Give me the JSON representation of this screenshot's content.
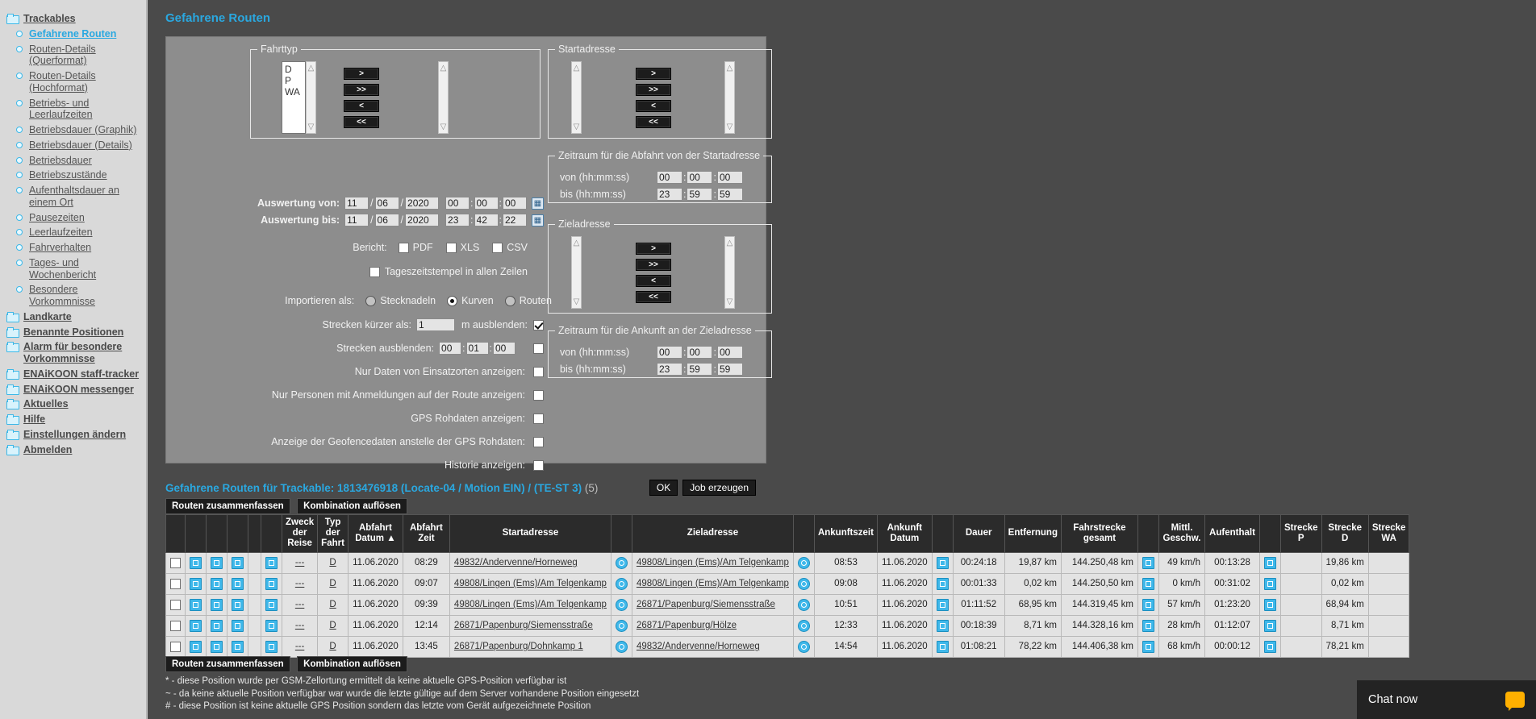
{
  "sidebar": {
    "items": [
      {
        "label": "Trackables",
        "type": "folder",
        "active": false
      },
      {
        "label": "Gefahrene Routen",
        "type": "leaf",
        "active": true
      },
      {
        "label": "Routen-Details (Querformat)",
        "type": "leaf",
        "active": false
      },
      {
        "label": "Routen-Details (Hochformat)",
        "type": "leaf",
        "active": false
      },
      {
        "label": "Betriebs- und Leerlaufzeiten",
        "type": "leaf",
        "active": false
      },
      {
        "label": "Betriebsdauer (Graphik)",
        "type": "leaf",
        "active": false
      },
      {
        "label": "Betriebsdauer (Details)",
        "type": "leaf",
        "active": false
      },
      {
        "label": "Betriebsdauer",
        "type": "leaf",
        "active": false
      },
      {
        "label": "Betriebszustände",
        "type": "leaf",
        "active": false
      },
      {
        "label": "Aufenthaltsdauer an einem Ort",
        "type": "leaf",
        "active": false
      },
      {
        "label": "Pausezeiten",
        "type": "leaf",
        "active": false
      },
      {
        "label": "Leerlaufzeiten",
        "type": "leaf",
        "active": false
      },
      {
        "label": "Fahrverhalten",
        "type": "leaf",
        "active": false
      },
      {
        "label": "Tages- und Wochenbericht",
        "type": "leaf",
        "active": false
      },
      {
        "label": "Besondere Vorkommnisse",
        "type": "leaf",
        "active": false
      },
      {
        "label": "Landkarte",
        "type": "folder",
        "active": false
      },
      {
        "label": "Benannte Positionen",
        "type": "folder",
        "active": false
      },
      {
        "label": "Alarm für besondere Vorkommnisse",
        "type": "folder",
        "active": false
      },
      {
        "label": "ENAiKOON staff-tracker",
        "type": "folder",
        "active": false
      },
      {
        "label": "ENAiKOON messenger",
        "type": "folder",
        "active": false
      },
      {
        "label": "Aktuelles",
        "type": "folder",
        "active": false
      },
      {
        "label": "Hilfe",
        "type": "folder",
        "active": false
      },
      {
        "label": "Einstellungen ändern",
        "type": "folder",
        "active": false
      },
      {
        "label": "Abmelden",
        "type": "folder",
        "active": false
      }
    ]
  },
  "page": {
    "title": "Gefahrene Routen",
    "accent_color": "#2aa8e0"
  },
  "form": {
    "fahrttyp": {
      "legend": "Fahrttyp",
      "available": [
        "D",
        "P",
        "WA"
      ],
      "selected": [],
      "buttons": [
        ">",
        ">>",
        "<",
        "<<"
      ]
    },
    "startadresse": {
      "legend": "Startadresse",
      "available": [],
      "selected": [],
      "buttons": [
        ">",
        ">>",
        "<",
        "<<"
      ]
    },
    "zieladresse": {
      "legend": "Zieladresse",
      "available": [],
      "selected": [],
      "buttons": [
        ">",
        ">>",
        "<",
        "<<"
      ]
    },
    "auswertung_von": {
      "label": "Auswertung von:",
      "day": "11",
      "month": "06",
      "year": "2020",
      "hh": "00",
      "mm": "00",
      "ss": "00"
    },
    "auswertung_bis": {
      "label": "Auswertung bis:",
      "day": "11",
      "month": "06",
      "year": "2020",
      "hh": "23",
      "mm": "42",
      "ss": "22"
    },
    "bericht": {
      "label": "Bericht:",
      "options": [
        {
          "label": "PDF",
          "checked": false
        },
        {
          "label": "XLS",
          "checked": false
        },
        {
          "label": "CSV",
          "checked": false
        }
      ]
    },
    "tageszeitstempel": {
      "label": "Tageszeitstempel in allen Zeilen",
      "checked": false
    },
    "importieren_als": {
      "label": "Importieren als:",
      "options": [
        {
          "label": "Stecknadeln",
          "selected": false
        },
        {
          "label": "Kurven",
          "selected": true
        },
        {
          "label": "Routen",
          "selected": false
        }
      ]
    },
    "strecken_kuerzer": {
      "label": "Strecken kürzer als:",
      "value": "1",
      "unit_label": "m ausblenden:",
      "checked": true
    },
    "strecken_ausblenden": {
      "label": "Strecken ausblenden:",
      "hh": "00",
      "mm": "01",
      "ss": "00",
      "checked": false
    },
    "nur_einsatzorte": {
      "label": "Nur Daten von Einsatzorten anzeigen:",
      "checked": false
    },
    "nur_personen": {
      "label": "Nur Personen mit Anmeldungen auf der Route anzeigen:",
      "checked": false
    },
    "gps_rohdaten": {
      "label": "GPS Rohdaten anzeigen:",
      "checked": false
    },
    "geofence": {
      "label": "Anzeige der Geofencedaten anstelle der GPS Rohdaten:",
      "checked": false
    },
    "historie": {
      "label": "Historie anzeigen:",
      "checked": false
    },
    "abfahrt_zeitraum": {
      "legend": "Zeitraum für die Abfahrt von der Startadresse",
      "von_label": "von (hh:mm:ss)",
      "von": {
        "hh": "00",
        "mm": "00",
        "ss": "00"
      },
      "bis_label": "bis (hh:mm:ss)",
      "bis": {
        "hh": "23",
        "mm": "59",
        "ss": "59"
      }
    },
    "ankunft_zeitraum": {
      "legend": "Zeitraum für die Ankunft an der Zieladresse",
      "von_label": "von (hh:mm:ss)",
      "von": {
        "hh": "00",
        "mm": "00",
        "ss": "00"
      },
      "bis_label": "bis (hh:mm:ss)",
      "bis": {
        "hh": "23",
        "mm": "59",
        "ss": "59"
      }
    },
    "ok_label": "OK",
    "job_label": "Job erzeugen"
  },
  "results": {
    "title": "Gefahrene Routen für Trackable: 1813476918 (Locate-04 / Motion EIN) / (TE-ST 3)",
    "count": "(5)",
    "btn_summarize": "Routen zusammenfassen",
    "btn_dissolve": "Kombination auflösen",
    "headers": [
      "",
      "",
      "",
      "",
      "",
      "",
      "Zweck der Reise",
      "Typ der Fahrt",
      "Abfahrt Datum ▲",
      "Abfahrt Zeit",
      "Startadresse",
      "",
      "Zieladresse",
      "",
      "Ankunftszeit",
      "Ankunft Datum",
      "",
      "Dauer",
      "Entfernung",
      "Fahrstrecke gesamt",
      "",
      "Mittl. Geschw.",
      "Aufenthalt",
      "",
      "Strecke P",
      "Strecke D",
      "Strecke WA"
    ],
    "rows": [
      {
        "zweck": "---",
        "typ": "D",
        "abfahrt_datum": "11.06.2020",
        "abfahrt_zeit": "08:29",
        "startadresse": "49832/Andervenne/Horneweg",
        "zieladresse": "49808/Lingen (Ems)/Am Telgenkamp",
        "ankunftszeit": "08:53",
        "ankunft_datum": "11.06.2020",
        "dauer": "00:24:18",
        "entfernung": "19,87 km",
        "fahrstrecke_gesamt": "144.250,48 km",
        "mittl_geschw": "49 km/h",
        "aufenthalt": "00:13:28",
        "strecke_p": "",
        "strecke_d": "19,86 km",
        "strecke_wa": ""
      },
      {
        "zweck": "---",
        "typ": "D",
        "abfahrt_datum": "11.06.2020",
        "abfahrt_zeit": "09:07",
        "startadresse": "49808/Lingen (Ems)/Am Telgenkamp",
        "zieladresse": "49808/Lingen (Ems)/Am Telgenkamp",
        "ankunftszeit": "09:08",
        "ankunft_datum": "11.06.2020",
        "dauer": "00:01:33",
        "entfernung": "0,02 km",
        "fahrstrecke_gesamt": "144.250,50 km",
        "mittl_geschw": "0 km/h",
        "aufenthalt": "00:31:02",
        "strecke_p": "",
        "strecke_d": "0,02 km",
        "strecke_wa": ""
      },
      {
        "zweck": "---",
        "typ": "D",
        "abfahrt_datum": "11.06.2020",
        "abfahrt_zeit": "09:39",
        "startadresse": "49808/Lingen (Ems)/Am Telgenkamp",
        "zieladresse": "26871/Papenburg/Siemensstraße",
        "ankunftszeit": "10:51",
        "ankunft_datum": "11.06.2020",
        "dauer": "01:11:52",
        "entfernung": "68,95 km",
        "fahrstrecke_gesamt": "144.319,45 km",
        "mittl_geschw": "57 km/h",
        "aufenthalt": "01:23:20",
        "strecke_p": "",
        "strecke_d": "68,94 km",
        "strecke_wa": ""
      },
      {
        "zweck": "---",
        "typ": "D",
        "abfahrt_datum": "11.06.2020",
        "abfahrt_zeit": "12:14",
        "startadresse": "26871/Papenburg/Siemensstraße",
        "zieladresse": "26871/Papenburg/Hölze",
        "ankunftszeit": "12:33",
        "ankunft_datum": "11.06.2020",
        "dauer": "00:18:39",
        "entfernung": "8,71 km",
        "fahrstrecke_gesamt": "144.328,16 km",
        "mittl_geschw": "28 km/h",
        "aufenthalt": "01:12:07",
        "strecke_p": "",
        "strecke_d": "8,71 km",
        "strecke_wa": ""
      },
      {
        "zweck": "---",
        "typ": "D",
        "abfahrt_datum": "11.06.2020",
        "abfahrt_zeit": "13:45",
        "startadresse": "26871/Papenburg/Dohnkamp 1",
        "zieladresse": "49832/Andervenne/Horneweg",
        "ankunftszeit": "14:54",
        "ankunft_datum": "11.06.2020",
        "dauer": "01:08:21",
        "entfernung": "78,22 km",
        "fahrstrecke_gesamt": "144.406,38 km",
        "mittl_geschw": "68 km/h",
        "aufenthalt": "00:00:12",
        "strecke_p": "",
        "strecke_d": "78,21 km",
        "strecke_wa": ""
      }
    ]
  },
  "footnotes": [
    "* - diese Position wurde per GSM-Zellortung ermittelt da keine aktuelle GPS-Position verfügbar ist",
    "~ - da keine aktuelle Position verfügbar war wurde die letzte gültige auf dem Server vorhandene Position eingesetzt",
    "# - diese Position ist keine aktuelle GPS Position sondern das letzte vom Gerät aufgezeichnete Position"
  ],
  "chat": {
    "label": "Chat now"
  }
}
